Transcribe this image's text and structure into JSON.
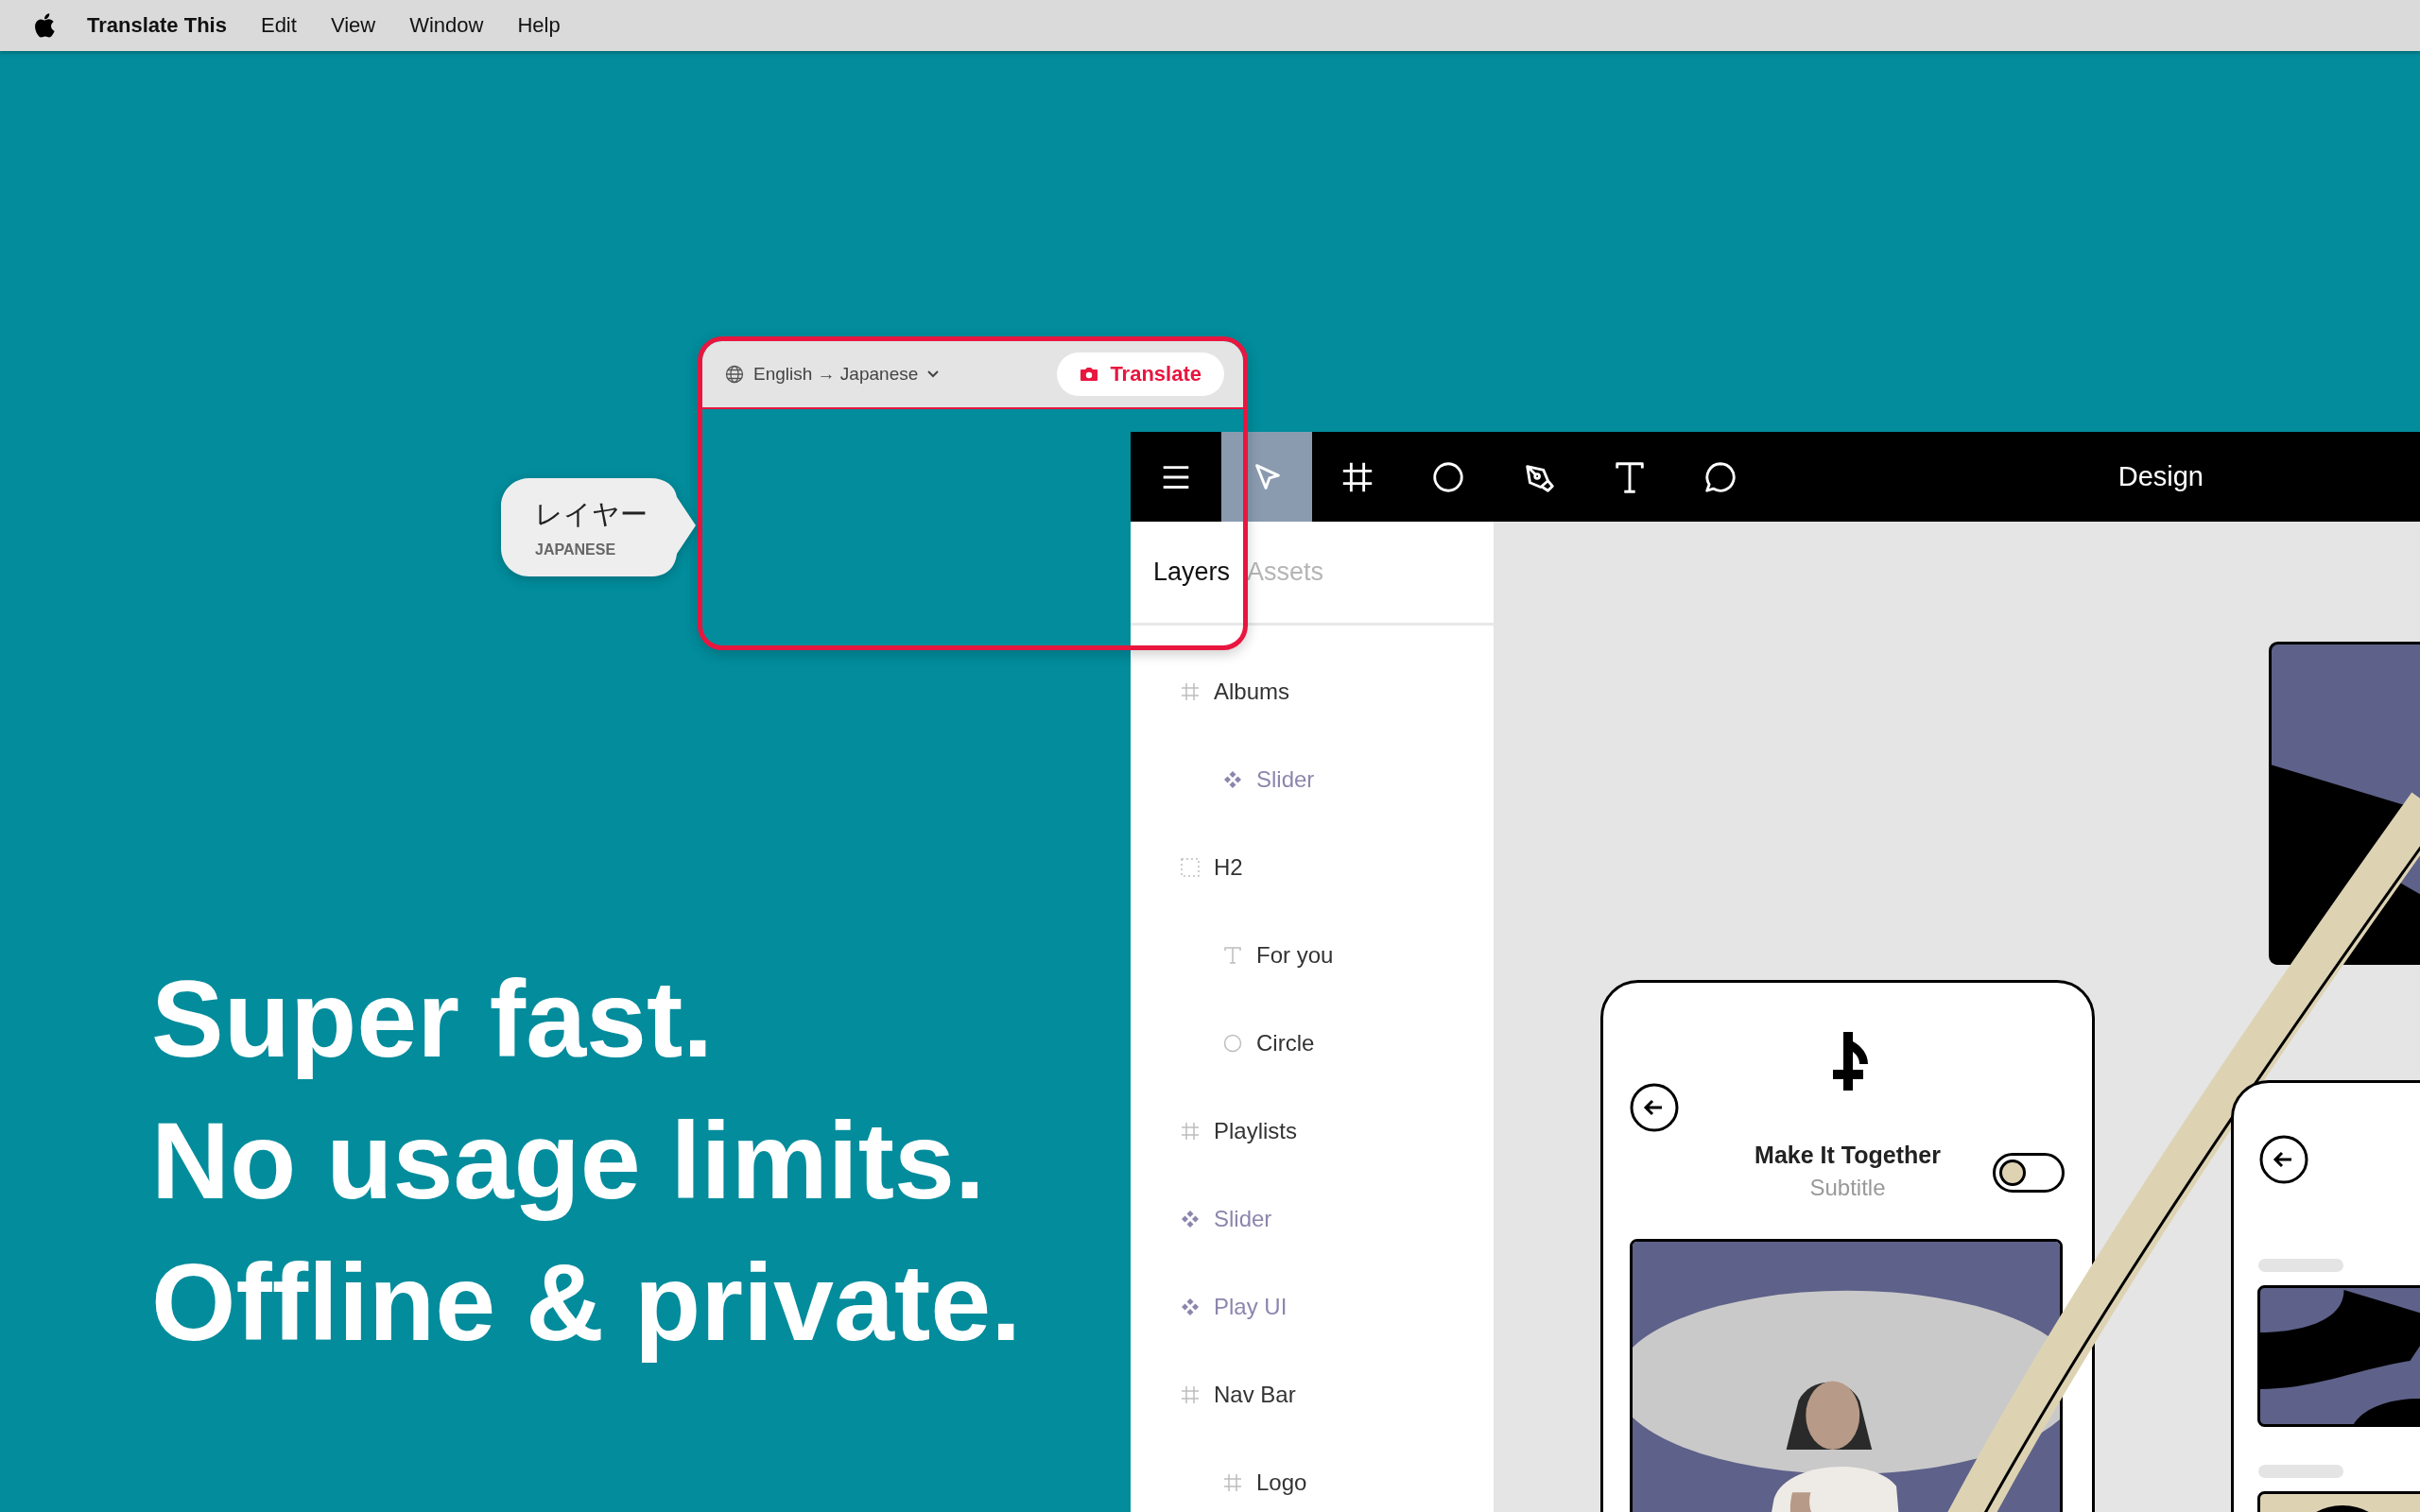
{
  "menu_bar": {
    "app_name": "Translate This",
    "items": [
      "Edit",
      "View",
      "Window",
      "Help"
    ]
  },
  "headline": [
    "Super fast.",
    "No usage limits.",
    "Offline & private."
  ],
  "translate_popup": {
    "language_pair": "English → Japanese",
    "button": "Translate"
  },
  "translation_bubble": {
    "text": "レイヤー",
    "language": "JAPANESE"
  },
  "design_app": {
    "tools": [
      {
        "kind": "menu",
        "selected": false
      },
      {
        "kind": "move",
        "selected": true
      },
      {
        "kind": "frame",
        "selected": false
      },
      {
        "kind": "ellipse",
        "selected": false
      },
      {
        "kind": "pen",
        "selected": false
      },
      {
        "kind": "text",
        "selected": false
      },
      {
        "kind": "comment",
        "selected": false
      }
    ],
    "mode_label": "Design",
    "panel_tabs": [
      {
        "label": "Layers",
        "selected": true
      },
      {
        "label": "Assets",
        "selected": false
      }
    ],
    "layers": [
      {
        "name": "Albums",
        "kind": "frame",
        "children": [
          {
            "name": "Slider",
            "kind": "component"
          }
        ]
      },
      {
        "name": "H2",
        "kind": "group",
        "children": [
          {
            "name": "For you",
            "kind": "text"
          },
          {
            "name": "Circle",
            "kind": "ellipse"
          }
        ]
      },
      {
        "name": "Playlists",
        "kind": "frame"
      },
      {
        "name": "Slider",
        "kind": "component"
      },
      {
        "name": "Play UI",
        "kind": "component"
      },
      {
        "name": "Nav Bar",
        "kind": "frame",
        "children": [
          {
            "name": "Logo",
            "kind": "frame"
          }
        ]
      }
    ],
    "canvas": {
      "screen_card": {
        "title": "Make It Together",
        "subtitle": "Subtitle",
        "toggle": {
          "on": false
        }
      }
    }
  }
}
